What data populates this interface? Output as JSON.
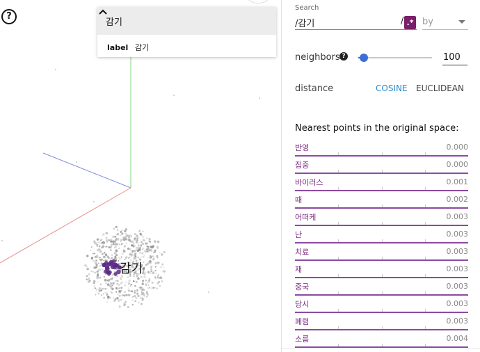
{
  "info_card": {
    "title": "감기",
    "label_key": "label",
    "label_value": "감기"
  },
  "point_label": "감기",
  "help_icon_glyph": "?",
  "search": {
    "label": "Search",
    "value": "/감기",
    "end_slash": "/",
    "regex_glyph": ".*",
    "by_placeholder": "by"
  },
  "neighbors": {
    "label": "neighbors",
    "help_glyph": "?",
    "value": "100",
    "slider_fraction": 0.08
  },
  "distance": {
    "label": "distance",
    "options": [
      "COSINE",
      "EUCLIDEAN"
    ],
    "selected": "COSINE"
  },
  "nearest": {
    "title": "Nearest points in the original space:",
    "items": [
      {
        "word": "반영",
        "value": "0.000"
      },
      {
        "word": "집중",
        "value": "0.000"
      },
      {
        "word": "바이러스",
        "value": "0.001"
      },
      {
        "word": "때",
        "value": "0.002"
      },
      {
        "word": "어떠케",
        "value": "0.003"
      },
      {
        "word": "난",
        "value": "0.003"
      },
      {
        "word": "치료",
        "value": "0.003"
      },
      {
        "word": "재",
        "value": "0.003"
      },
      {
        "word": "중국",
        "value": "0.003"
      },
      {
        "word": "당시",
        "value": "0.003"
      },
      {
        "word": "폐렴",
        "value": "0.003"
      },
      {
        "word": "소름",
        "value": "0.004"
      }
    ]
  },
  "colors": {
    "accent": "#3b6fd6",
    "cosine": "#2a8bd1",
    "neighbor_word": "#7b2a82",
    "neighbor_bar": "#8b4aa0",
    "regex_btn": "#7b1f6a",
    "selected_points": "#5b2a86"
  }
}
